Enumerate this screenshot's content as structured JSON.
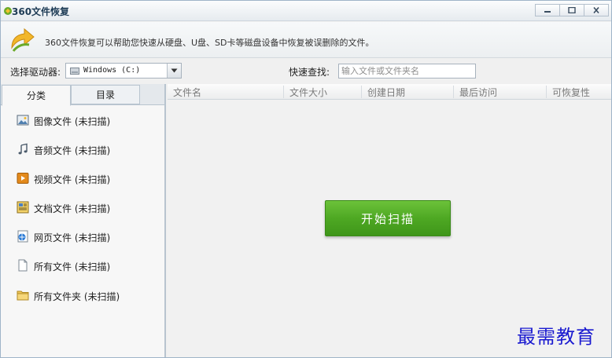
{
  "window": {
    "title": "360文件恢复",
    "minimize_icon": "minimize-icon",
    "maximize_icon": "maximize-icon",
    "close_icon": "close-icon"
  },
  "banner": {
    "text": "360文件恢复可以帮助您快速从硬盘、U盘、SD卡等磁盘设备中恢复被误删除的文件。"
  },
  "toolbar": {
    "drive_label": "选择驱动器:",
    "drive_value": "Windows (C:)",
    "search_label": "快速查找:",
    "search_placeholder": "输入文件或文件夹名"
  },
  "tabs": [
    {
      "label": "分类",
      "active": true
    },
    {
      "label": "目录",
      "active": false
    }
  ],
  "categories": [
    {
      "label": "图像文件 (未扫描)",
      "icon": "image-file-icon"
    },
    {
      "label": "音频文件 (未扫描)",
      "icon": "music-note-icon"
    },
    {
      "label": "视频文件 (未扫描)",
      "icon": "video-file-icon"
    },
    {
      "label": "文档文件 (未扫描)",
      "icon": "document-file-icon"
    },
    {
      "label": "网页文件 (未扫描)",
      "icon": "web-page-icon"
    },
    {
      "label": "所有文件 (未扫描)",
      "icon": "blank-file-icon"
    },
    {
      "label": "所有文件夹 (未扫描)",
      "icon": "folder-icon"
    }
  ],
  "table": {
    "columns": [
      "文件名",
      "文件大小",
      "创建日期",
      "最后访问",
      "可恢复性"
    ]
  },
  "scan_button": {
    "label": "开始扫描"
  },
  "watermark": {
    "text": "最需教育"
  },
  "colors": {
    "scan_button": "#4ea823",
    "watermark": "#1a1ad0"
  }
}
